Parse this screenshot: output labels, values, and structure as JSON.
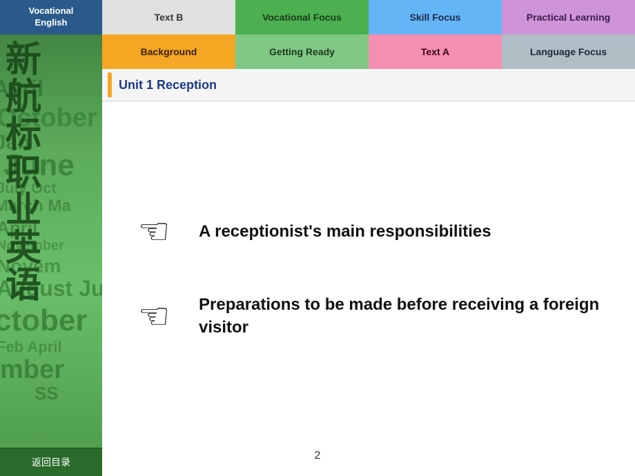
{
  "sidebar": {
    "header_line1": "Vocational",
    "header_line2": "English",
    "chinese_chars": [
      "新",
      "航",
      "标",
      "职",
      "业",
      "英",
      "语"
    ],
    "bottom_btn": "返回目录"
  },
  "nav": {
    "row1": [
      {
        "id": "tab-textb",
        "label": "Text B",
        "style": "textb"
      },
      {
        "id": "tab-vocational",
        "label": "Vocational Focus",
        "style": "vocational"
      },
      {
        "id": "tab-skillfocus",
        "label": "Skill Focus",
        "style": "skillfocus"
      },
      {
        "id": "tab-practical",
        "label": "Practical Learning",
        "style": "practical"
      }
    ],
    "row2": [
      {
        "id": "tab-background",
        "label": "Background",
        "style": "background"
      },
      {
        "id": "tab-gettingready",
        "label": "Getting Ready",
        "style": "gettingready"
      },
      {
        "id": "tab-texta",
        "label": "Text A",
        "style": "texta"
      },
      {
        "id": "tab-language",
        "label": "Language Focus",
        "style": "language"
      }
    ]
  },
  "unit_bar": {
    "title": "Unit 1 Reception"
  },
  "main": {
    "item1": {
      "text": "A receptionist's main responsibilities"
    },
    "item2": {
      "text": "Preparations to be made before receiving a foreign visitor"
    }
  },
  "page": {
    "number": "2"
  }
}
